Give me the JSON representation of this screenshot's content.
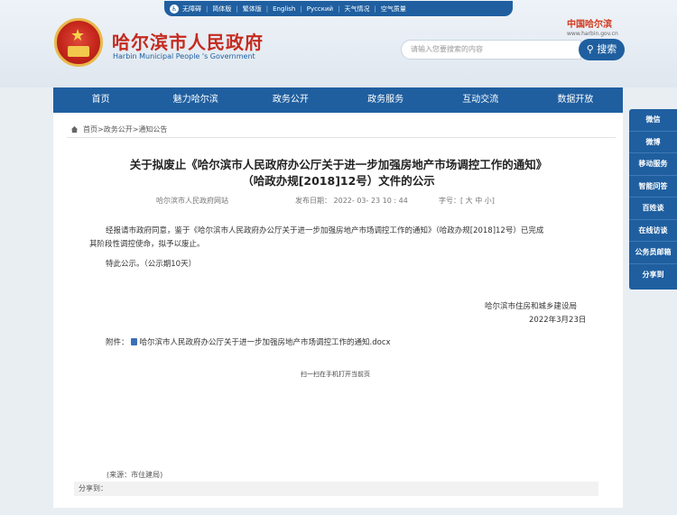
{
  "topbar": {
    "items": [
      "无障碍",
      "简体版",
      "繁体版",
      "English",
      "Русский",
      "天气情况",
      "空气质量"
    ]
  },
  "header": {
    "site_title": "哈尔滨市人民政府",
    "site_subtitle": "Harbin Municipal People 's Government",
    "logo_text": "中国哈尔滨",
    "logo_url": "www.harbin.gov.cn"
  },
  "search": {
    "placeholder": "请输入您要搜索的内容",
    "button_label": "搜索"
  },
  "nav": {
    "items": [
      "首页",
      "魅力哈尔滨",
      "政务公开",
      "政务服务",
      "互动交流",
      "数据开放"
    ]
  },
  "breadcrumb": "首页>政务公开>通知公告",
  "article": {
    "title_line1": "关于拟废止《哈尔滨市人民政府办公厅关于进一步加强房地产市场调控工作的通知》",
    "title_line2": "（哈政办规[2018]12号）文件的公示",
    "source_site": "哈尔滨市人民政府网站",
    "publish_time": "发布日期： 2022- 03- 23   10 : 44",
    "font_size": "字号：[ 大 中 小]",
    "para1_line1": "经报请市政府同意，鉴于《哈尔滨市人民政府办公厅关于进一步加强房地产市场调控工作的通知》（哈政办规[2018]12号）已完成",
    "para1_line2": "其阶段性调控使命，拟予以废止。",
    "para2": "特此公示。（公示期10天）",
    "sign_org": "哈尔滨市住房和城乡建设局",
    "sign_date": "2022年3月23日",
    "attach_label": "附件：",
    "attach_file": "哈尔滨市人民政府办公厅关于进一步加强房地产市场调控工作的通知.docx",
    "qr_note": "扫一扫在手机打开当前页",
    "source_note": "(来源：市住建局)",
    "share_label": "分享到："
  },
  "side_panel": {
    "items": [
      "微信",
      "微博",
      "移动服务",
      "智能问答",
      "百姓谈",
      "在线访谈",
      "公务员邮箱",
      "分享到"
    ]
  },
  "colors": {
    "primary_blue": "#1f5fa0",
    "title_red": "#c52b20"
  }
}
